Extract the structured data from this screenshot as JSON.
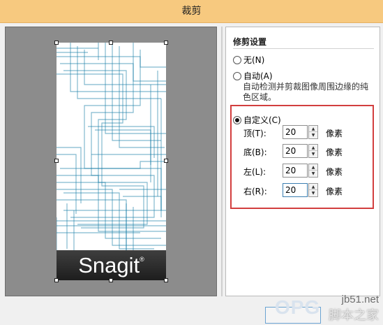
{
  "window": {
    "title": "裁剪"
  },
  "preview": {
    "brand_text": "Snagit",
    "brand_mark": "®",
    "stroke_color": "#1b7fa8"
  },
  "settings": {
    "section_title": "修剪设置",
    "options": {
      "none": {
        "label": "无(N)",
        "selected": false
      },
      "auto": {
        "label": "自动(A)",
        "selected": false,
        "description": "自动检测并剪裁图像周围边缘的纯色区域。"
      },
      "custom": {
        "label": "自定义(C)",
        "selected": true
      }
    },
    "fields": [
      {
        "label": "顶(T):",
        "value": "20",
        "unit": "像素"
      },
      {
        "label": "底(B):",
        "value": "20",
        "unit": "像素"
      },
      {
        "label": "左(L):",
        "value": "20",
        "unit": "像素"
      },
      {
        "label": "右(R):",
        "value": "20",
        "unit": "像素"
      }
    ],
    "highlight_color": "#d23e3e"
  },
  "watermark": {
    "site": "jb51.net",
    "cn_text": "脚本之家",
    "logo_text": "OPG"
  }
}
